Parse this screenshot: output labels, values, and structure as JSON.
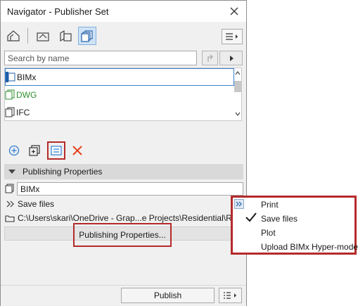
{
  "window": {
    "title": "Navigator - Publisher Set"
  },
  "search": {
    "placeholder": "Search by name"
  },
  "list": {
    "items": [
      {
        "label": "BIMx",
        "color": "#1a1a1a",
        "selected": true
      },
      {
        "label": "DWG",
        "color": "#2f8f2f",
        "selected": false
      },
      {
        "label": "IFC",
        "color": "#1a1a1a",
        "selected": false
      }
    ]
  },
  "section": {
    "title": "Publishing Properties"
  },
  "properties": {
    "name_value": "BIMx",
    "format_label": "Save files",
    "path": "C:\\Users\\skari\\OneDrive - Grap...e Projects\\Residential\\Release",
    "button_label": "Publishing Properties..."
  },
  "footer": {
    "publish_label": "Publish"
  },
  "popup_menu": {
    "items": [
      {
        "label": "Print",
        "checked": false
      },
      {
        "label": "Save files",
        "checked": true
      },
      {
        "label": "Plot",
        "checked": false
      },
      {
        "label": "Upload BIMx Hyper-model",
        "checked": false
      }
    ]
  },
  "colors": {
    "accent": "#3b82d1",
    "highlight": "#b52a2a",
    "delete": "#e8431c",
    "add": "#2f7fd8"
  }
}
